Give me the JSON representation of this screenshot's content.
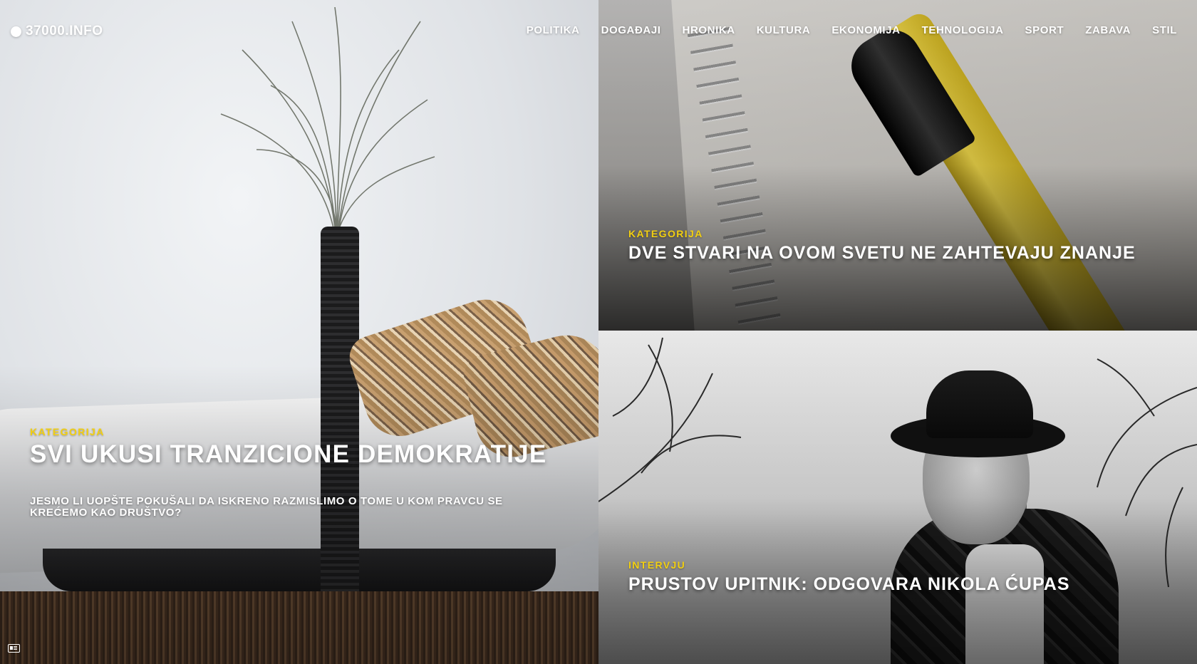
{
  "header": {
    "logo_text": "37000.INFO",
    "nav": [
      {
        "label": "POLITIKA"
      },
      {
        "label": "DOGAĐAJI"
      },
      {
        "label": "HRONIKA"
      },
      {
        "label": "KULTURA"
      },
      {
        "label": "EKONOMIJA"
      },
      {
        "label": "TEHNOLOGIJA"
      },
      {
        "label": "SPORT"
      },
      {
        "label": "ZABAVA"
      },
      {
        "label": "STIL"
      }
    ]
  },
  "articles": [
    {
      "category": "KATEGORIJA",
      "title": "SVI UKUSI TRANZICIONE DEMOKRATIJE",
      "excerpt": "JESMO LI UOPŠTE POKUŠALI DA ISKRENO RAZMISLIMO O TOME U KOM PRAVCU SE KREĆEMO KAO DRUŠTVO?"
    },
    {
      "category": "KATEGORIJA",
      "title": "DVE STVARI NA OVOM SVETU NE ZAHTEVAJU ZNANJE"
    },
    {
      "category": "INTERVJU",
      "title": "PRUSTOV UPITNIK: ODGOVARA NIKOLA ĆUPAS"
    }
  ],
  "colors": {
    "category_accent": "#f2cf11",
    "text": "#ffffff"
  },
  "icons": {
    "logo": "circle-icon",
    "corner_widget": "newspaper-icon"
  }
}
